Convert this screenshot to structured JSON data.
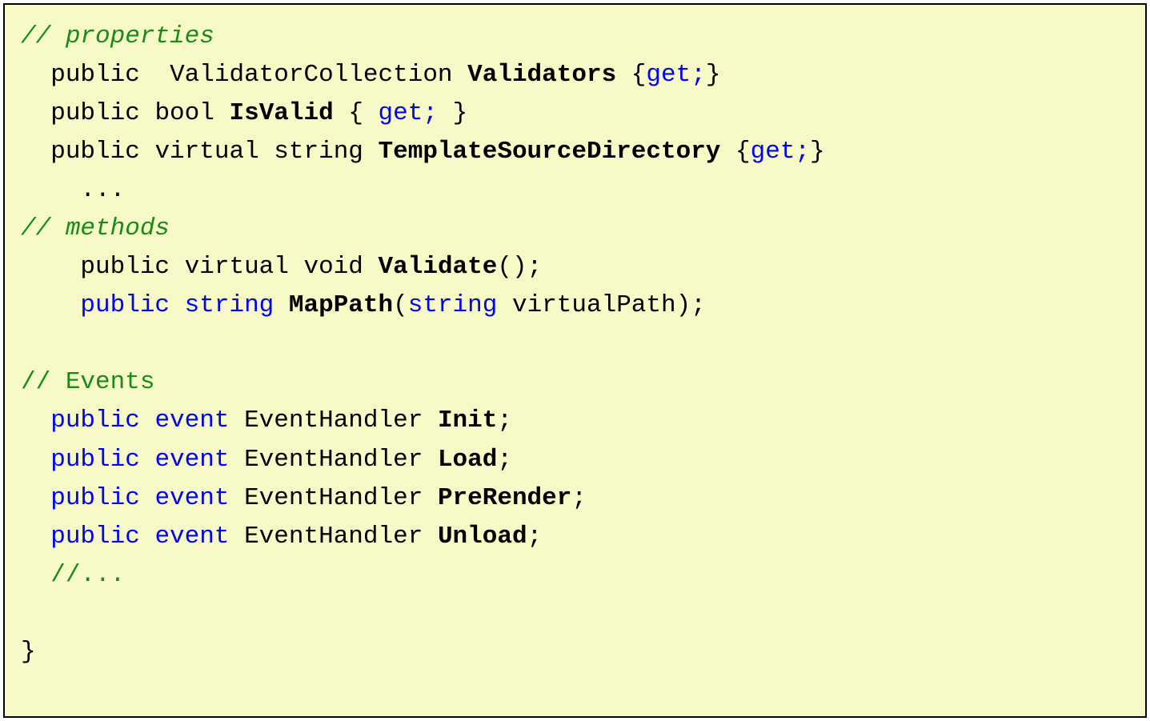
{
  "code": {
    "line1": {
      "prefix": "// ",
      "text": "properties"
    },
    "line2": {
      "indent": "  ",
      "mod1": "public",
      "sp1": "  ",
      "type": "ValidatorCollection",
      "sp2": " ",
      "name": "Validators",
      "sp3": " ",
      "brace_open": "{",
      "get": "get;",
      "brace_close": "}"
    },
    "line3": {
      "indent": "  ",
      "mod1": "public",
      "sp1": " ",
      "type": "bool",
      "sp2": " ",
      "name": "IsValid",
      "sp3": " ",
      "brace_open": "{ ",
      "get": "get;",
      "brace_close": " }"
    },
    "line4": {
      "indent": "  ",
      "mod1": "public",
      "sp1": " ",
      "mod2": "virtual",
      "sp2": " ",
      "type": "string",
      "sp3": " ",
      "name": "TemplateSourceDirectory",
      "sp4": " ",
      "brace_open": "{",
      "get": "get;",
      "brace_close": "}"
    },
    "line5": {
      "indent": "    ",
      "text": "..."
    },
    "line6": {
      "prefix": "// ",
      "text": "methods"
    },
    "line7": {
      "indent": "    ",
      "mod1": "public",
      "sp1": " ",
      "mod2": "virtual",
      "sp2": " ",
      "type": "void",
      "sp3": " ",
      "name": "Validate",
      "rest": "();"
    },
    "line8": {
      "indent": "    ",
      "mod1": "public",
      "sp1": " ",
      "type": "string",
      "sp2": " ",
      "name": "MapPath",
      "paren_open": "(",
      "param_type": "string",
      "sp3": " ",
      "param_name": "virtualPath",
      "paren_close": ");"
    },
    "line9": "",
    "line10": {
      "prefix": "// ",
      "text": "Events"
    },
    "line11": {
      "indent": "  ",
      "mod1": "public",
      "sp1": " ",
      "mod2": "event",
      "sp2": " ",
      "type": "EventHandler",
      "sp3": " ",
      "name": "Init",
      "rest": ";"
    },
    "line12": {
      "indent": "  ",
      "mod1": "public",
      "sp1": " ",
      "mod2": "event",
      "sp2": " ",
      "type": "EventHandler",
      "sp3": " ",
      "name": "Load",
      "rest": ";"
    },
    "line13": {
      "indent": "  ",
      "mod1": "public",
      "sp1": " ",
      "mod2": "event",
      "sp2": " ",
      "type": "EventHandler",
      "sp3": " ",
      "name": "PreRender",
      "rest": ";"
    },
    "line14": {
      "indent": "  ",
      "mod1": "public",
      "sp1": " ",
      "mod2": "event",
      "sp2": " ",
      "type": "EventHandler",
      "sp3": " ",
      "name": "Unload",
      "rest": ";"
    },
    "line15": {
      "indent": "  ",
      "text": "//..."
    },
    "line16": "",
    "line17": {
      "text": "}"
    }
  }
}
